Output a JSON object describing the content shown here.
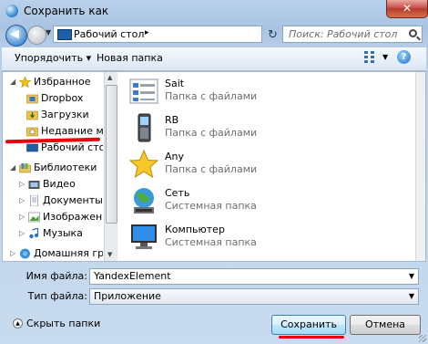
{
  "window": {
    "title": "Сохранить как",
    "close_label": "✕"
  },
  "navbar": {
    "back_label": "◀",
    "address_text": "Рабочий стол",
    "address_arrow": "▸",
    "search_placeholder": "Поиск: Рабочий стол"
  },
  "toolbar": {
    "organize_label": "Упорядочить ▾",
    "new_folder_label": "Новая папка",
    "help_label": "?"
  },
  "nav": {
    "favorites": {
      "label": "Избранное",
      "items": [
        "Dropbox",
        "Загрузки",
        "Недавние места",
        "Рабочий стол"
      ]
    },
    "libraries": {
      "label": "Библиотеки",
      "items": [
        "Видео",
        "Документы",
        "Изображения",
        "Музыка"
      ]
    },
    "homegroup": {
      "label": "Домашняя группа"
    }
  },
  "files": [
    {
      "name": "Sait",
      "type": "Папка с файлами",
      "icon": "folder-list-icon"
    },
    {
      "name": "RB",
      "type": "Папка с файлами",
      "icon": "phone-icon"
    },
    {
      "name": "Any",
      "type": "Папка с файлами",
      "icon": "star-icon"
    },
    {
      "name": "Сеть",
      "type": "Системная папка",
      "icon": "network-icon"
    },
    {
      "name": "Компьютер",
      "type": "Системная папка",
      "icon": "computer-icon"
    }
  ],
  "fields": {
    "filename_label": "Имя файла:",
    "filename_value": "YandexElement",
    "filetype_label": "Тип файла:",
    "filetype_value": "Приложение"
  },
  "footer": {
    "hide_folders_label": "Скрыть папки",
    "save_label": "Сохранить",
    "cancel_label": "Отмена"
  },
  "colors": {
    "highlight_marker": "#e8000d",
    "window_frame": "#b9d1ea"
  }
}
